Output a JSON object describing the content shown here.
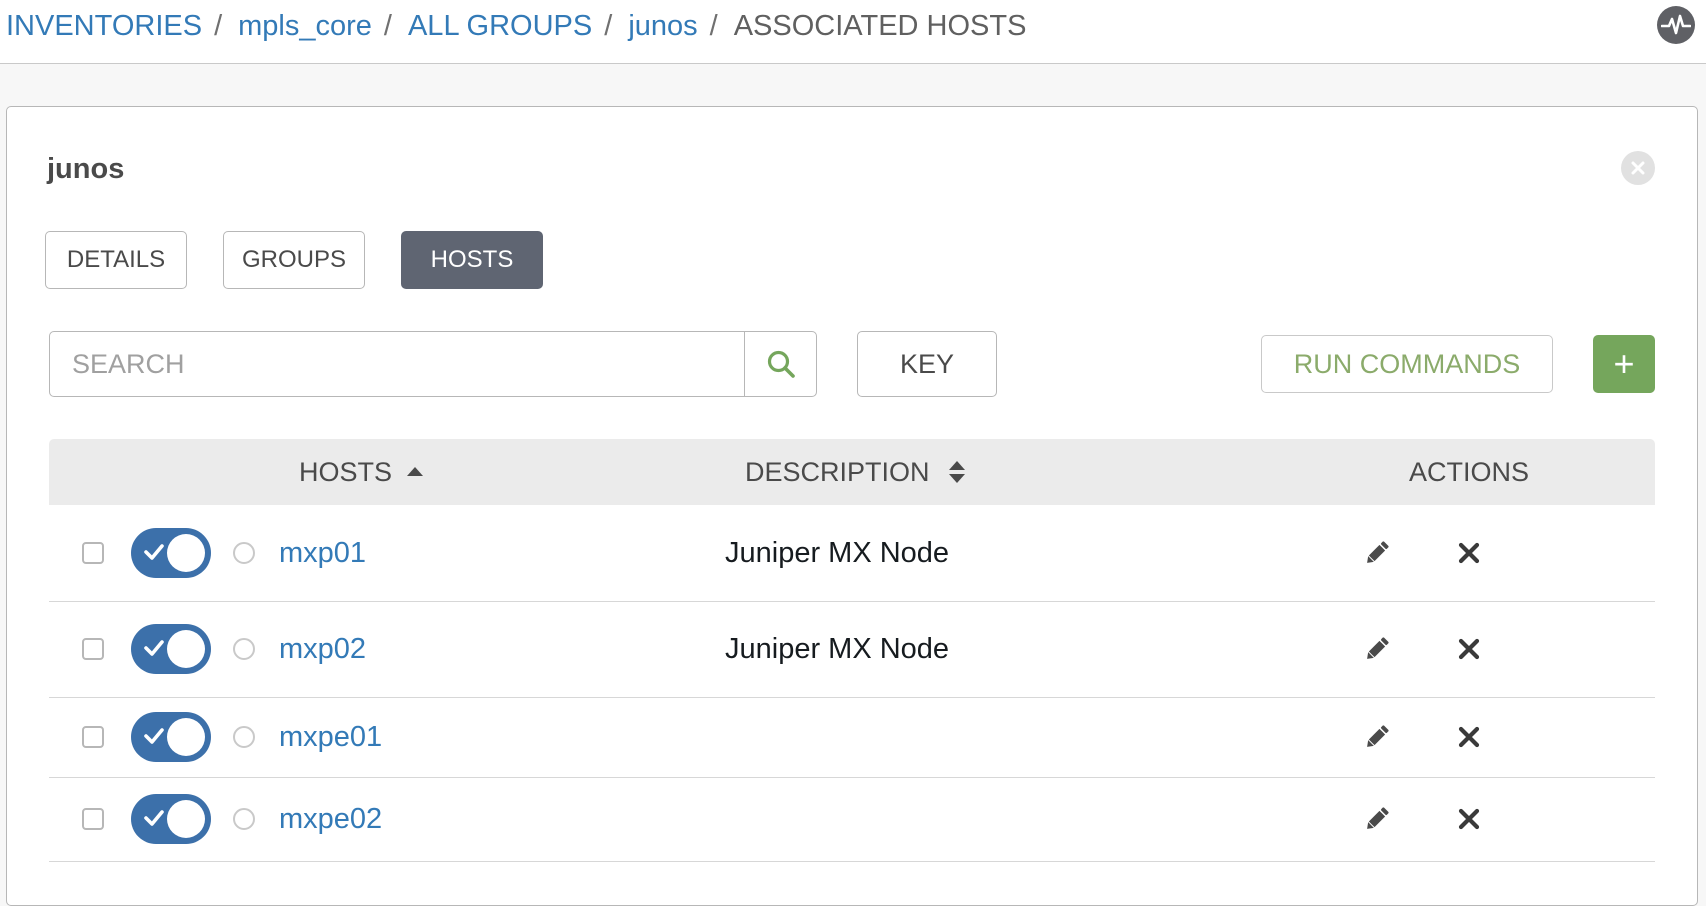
{
  "breadcrumb": {
    "items": [
      {
        "label": "INVENTORIES"
      },
      {
        "label": "mpls_core"
      },
      {
        "label": "ALL GROUPS"
      },
      {
        "label": "junos"
      }
    ],
    "separator": "/",
    "current": "ASSOCIATED HOSTS"
  },
  "header_icon": "activity-stream-icon",
  "panel": {
    "title": "junos",
    "tabs": [
      {
        "label": "DETAILS",
        "active": false
      },
      {
        "label": "GROUPS",
        "active": false
      },
      {
        "label": "HOSTS",
        "active": true
      }
    ]
  },
  "toolbar": {
    "search_placeholder": "SEARCH",
    "key_label": "KEY",
    "run_commands_label": "RUN COMMANDS",
    "add_label": "+"
  },
  "table": {
    "columns": {
      "hosts": "HOSTS",
      "description": "DESCRIPTION",
      "actions": "ACTIONS"
    },
    "rows": [
      {
        "name": "mxp01",
        "description": "Juniper MX Node",
        "enabled": true
      },
      {
        "name": "mxp02",
        "description": "Juniper MX Node",
        "enabled": true
      },
      {
        "name": "mxpe01",
        "description": "",
        "enabled": true
      },
      {
        "name": "mxpe02",
        "description": "",
        "enabled": true
      }
    ]
  },
  "colors": {
    "link": "#337ab7",
    "toggle": "#3c70aa",
    "active_tab": "#5f6572",
    "add_button": "#75a65c",
    "run_commands_text": "#8bab6b"
  }
}
